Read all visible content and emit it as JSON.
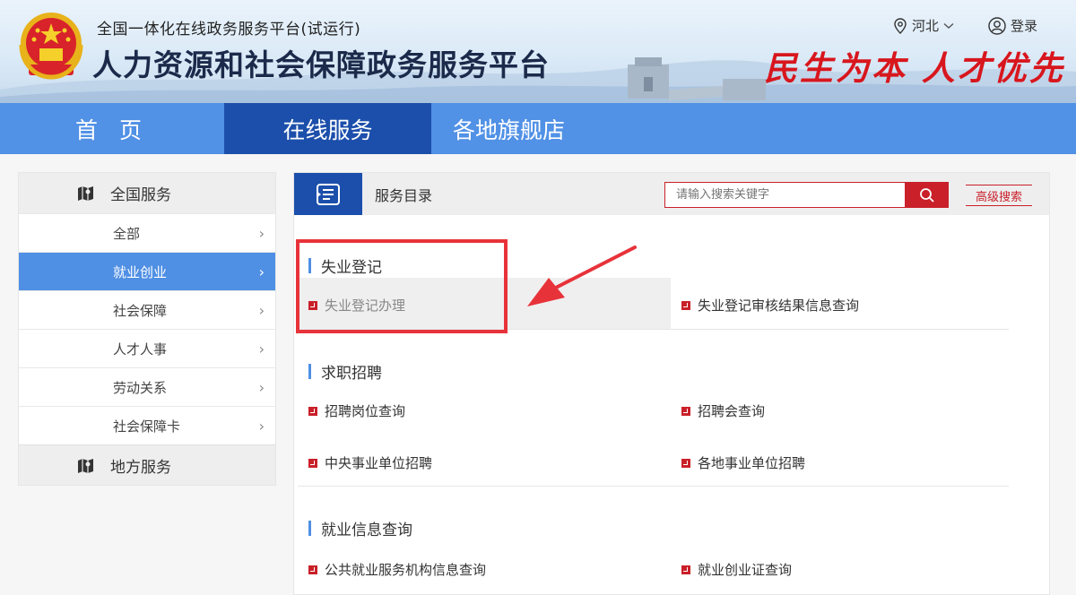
{
  "header": {
    "subtitle": "全国一体化在线政务服务平台(试运行)",
    "title": "人力资源和社会保障政务服务平台",
    "slogan": "民生为本 人才优先",
    "region": "河北",
    "login": "登录"
  },
  "nav": {
    "items": [
      {
        "label": "首 页"
      },
      {
        "label": "在线服务"
      },
      {
        "label": "各地旗舰店"
      }
    ]
  },
  "sidebar": {
    "national": "全国服务",
    "items": [
      {
        "label": "全部"
      },
      {
        "label": "就业创业"
      },
      {
        "label": "社会保障"
      },
      {
        "label": "人才人事"
      },
      {
        "label": "劳动关系"
      },
      {
        "label": "社会保障卡"
      }
    ],
    "local": "地方服务"
  },
  "main": {
    "header_label": "服务目录",
    "search_placeholder": "请输入搜索关键字",
    "advanced_search": "高级搜索",
    "sections": [
      {
        "title": "失业登记",
        "links": [
          "失业登记办理",
          "失业登记审核结果信息查询"
        ]
      },
      {
        "title": "求职招聘",
        "links": [
          "招聘岗位查询",
          "招聘会查询",
          "中央事业单位招聘",
          "各地事业单位招聘"
        ]
      },
      {
        "title": "就业信息查询",
        "links": [
          "公共就业服务机构信息查询",
          "就业创业证查询"
        ]
      }
    ]
  },
  "colors": {
    "nav_bg": "#5191e6",
    "nav_active": "#1c4fab",
    "accent_red": "#c9202a",
    "sidebar_active": "#4f8fe4",
    "annotation_red": "#e8323a"
  }
}
